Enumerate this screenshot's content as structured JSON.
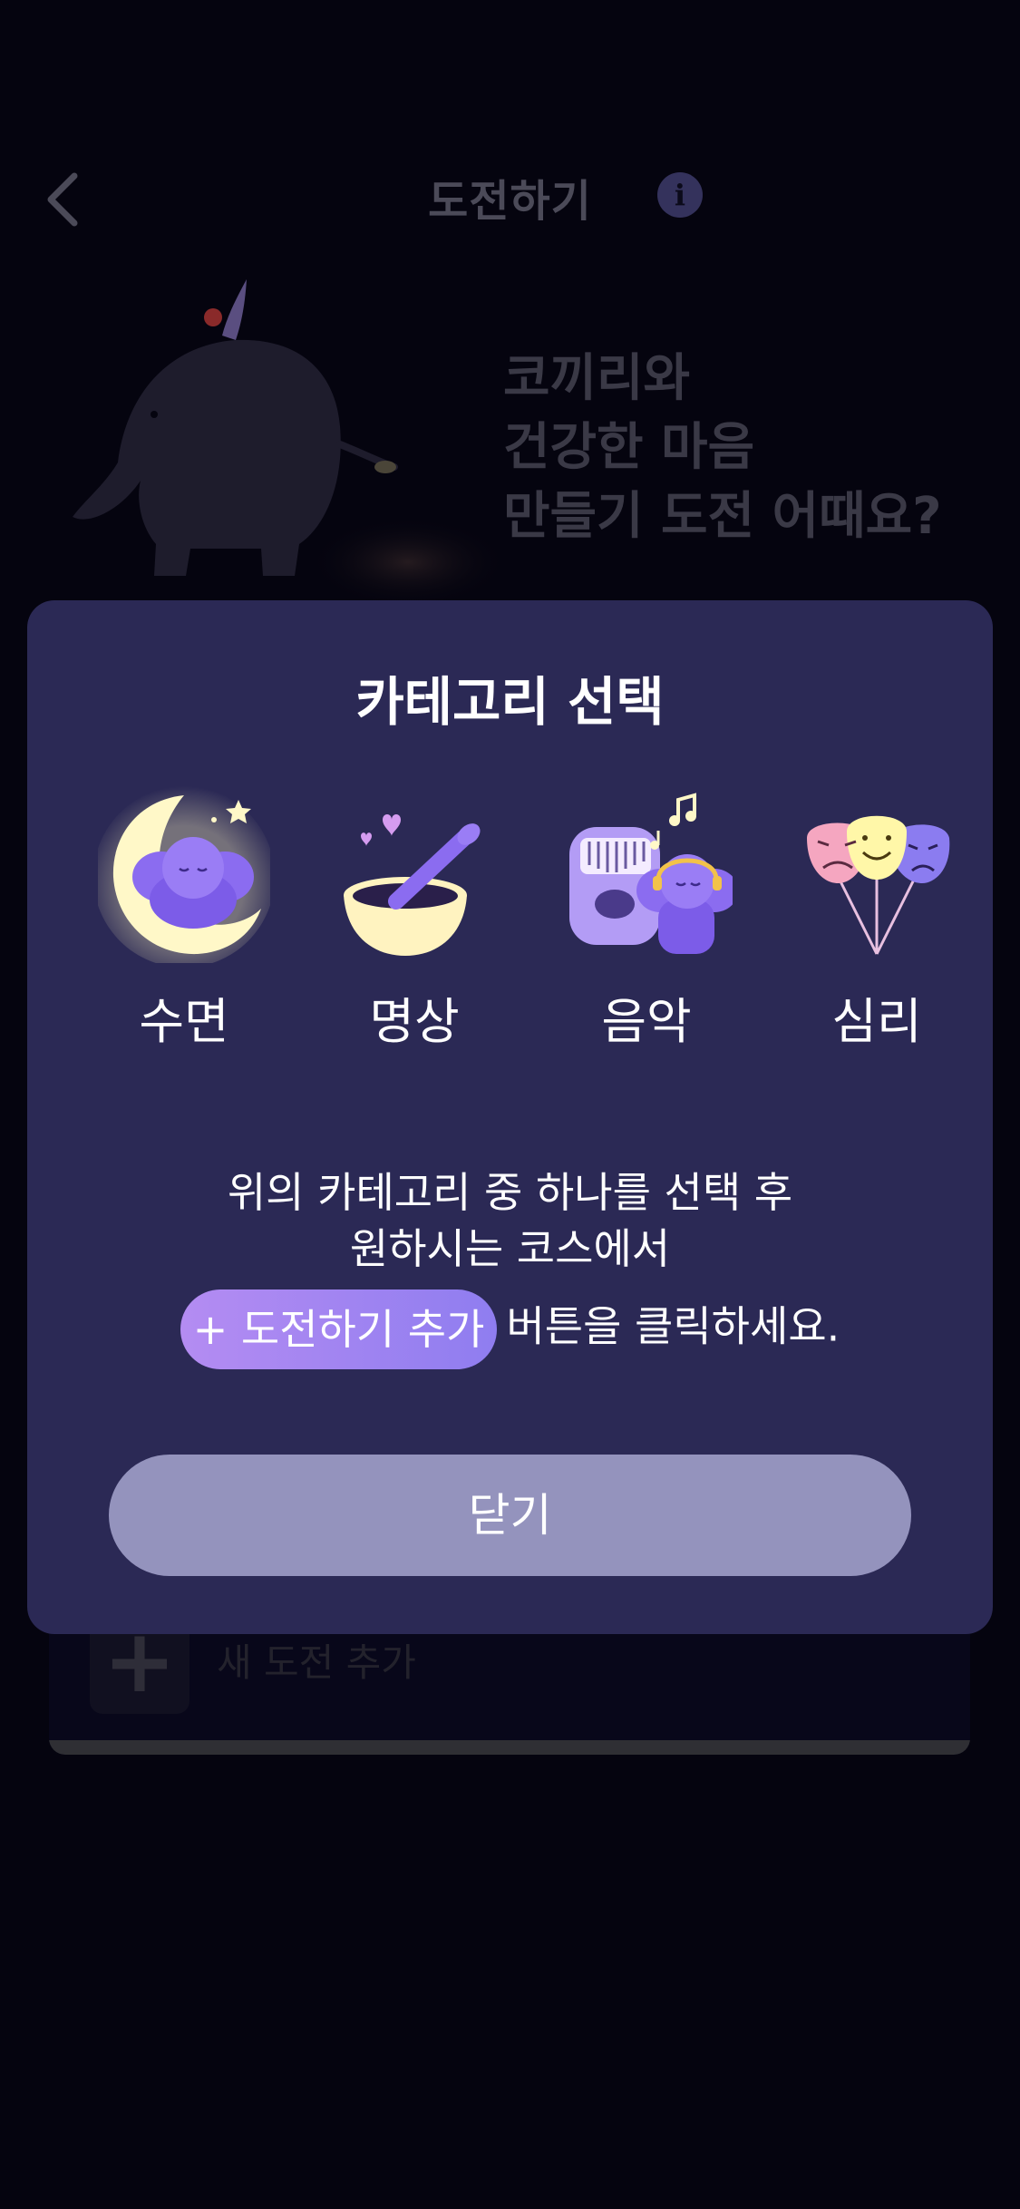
{
  "header": {
    "title": "도전하기",
    "back_icon": "chevron-left-icon",
    "info_icon": "info-icon",
    "info_glyph": "i"
  },
  "hero": {
    "lines": [
      "코끼리와",
      "건강한 마음",
      "만들기 도전 어때요?"
    ]
  },
  "background_card": {
    "plus_glyph": "+",
    "label": "새 도전 추가"
  },
  "modal": {
    "title": "카테고리 선택",
    "categories": [
      {
        "label": "수면",
        "icon": "moon-elephant-icon"
      },
      {
        "label": "명상",
        "icon": "singing-bowl-icon"
      },
      {
        "label": "음악",
        "icon": "kalimba-elephant-icon"
      },
      {
        "label": "심리",
        "icon": "emotion-masks-icon"
      }
    ],
    "instructions": {
      "line1": "위의 카테고리 중 하나를 선택 후",
      "line2": "원하시는 코스에서",
      "pill": "+ 도전하기 추가",
      "line3_rest": "버튼을 클릭하세요."
    },
    "close_label": "닫기"
  },
  "colors": {
    "background": "#05040f",
    "modal": "#2b2955",
    "close_button": "#9493bd",
    "pill_start": "#b48cf2",
    "pill_end": "#8f7df0",
    "accent_purple": "#7b5ce6",
    "moon_yellow": "#fff8c8"
  }
}
